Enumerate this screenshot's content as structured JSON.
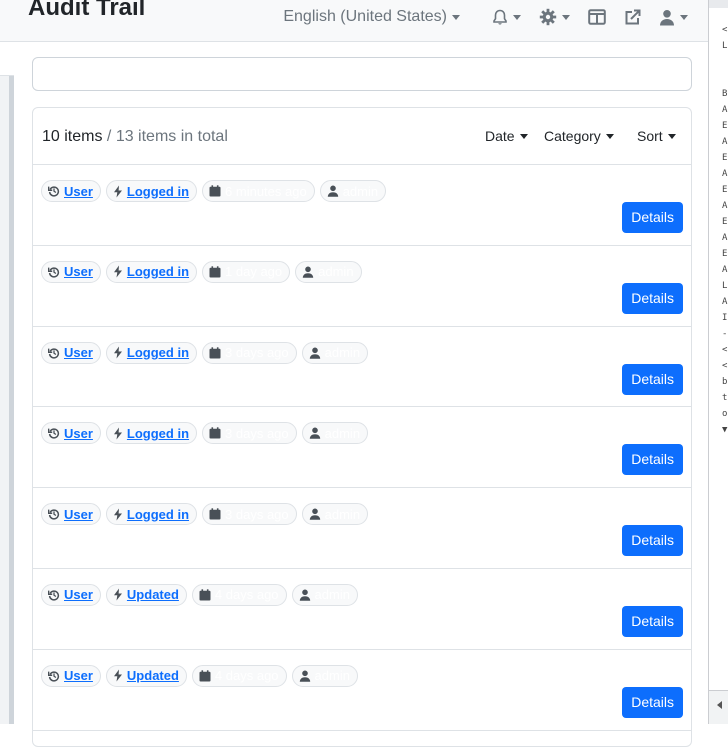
{
  "header": {
    "title": "Audit Trail",
    "language": "English (United States)",
    "icons": [
      "bell-icon",
      "gear-icon",
      "layout-icon",
      "external-link-icon",
      "user-icon"
    ]
  },
  "search": {
    "value": "",
    "placeholder": ""
  },
  "list": {
    "count_label": "10 items",
    "total_label": "/ 13 items in total",
    "filters": {
      "date": "Date",
      "category": "Category",
      "sort": "Sort"
    },
    "rows": [
      {
        "type": "User",
        "action": "Logged in",
        "time": "6 minutes ago",
        "user": "admin",
        "details": "Details"
      },
      {
        "type": "User",
        "action": "Logged in",
        "time": "1 day ago",
        "user": "admin",
        "details": "Details"
      },
      {
        "type": "User",
        "action": "Logged in",
        "time": "3 days ago",
        "user": "admin",
        "details": "Details"
      },
      {
        "type": "User",
        "action": "Logged in",
        "time": "3 days ago",
        "user": "admin",
        "details": "Details"
      },
      {
        "type": "User",
        "action": "Logged in",
        "time": "3 days ago",
        "user": "admin",
        "details": "Details"
      },
      {
        "type": "User",
        "action": "Updated",
        "time": "4 days ago",
        "user": "admin",
        "details": "Details"
      },
      {
        "type": "User",
        "action": "Updated",
        "time": "4 days ago",
        "user": "admin",
        "details": "Details"
      }
    ]
  },
  "devtools": {
    "code_lines": [
      "<",
      "L",
      "",
      "",
      "B",
      "A",
      "E",
      "A",
      "E",
      "A",
      "E",
      "A",
      "E",
      "A",
      "E",
      "A",
      "L",
      "A",
      "I",
      "-",
      "<",
      "<",
      "b",
      "t",
      "o",
      "▼"
    ]
  },
  "colors": {
    "primary": "#0d6efd",
    "muted": "#6c757d"
  }
}
